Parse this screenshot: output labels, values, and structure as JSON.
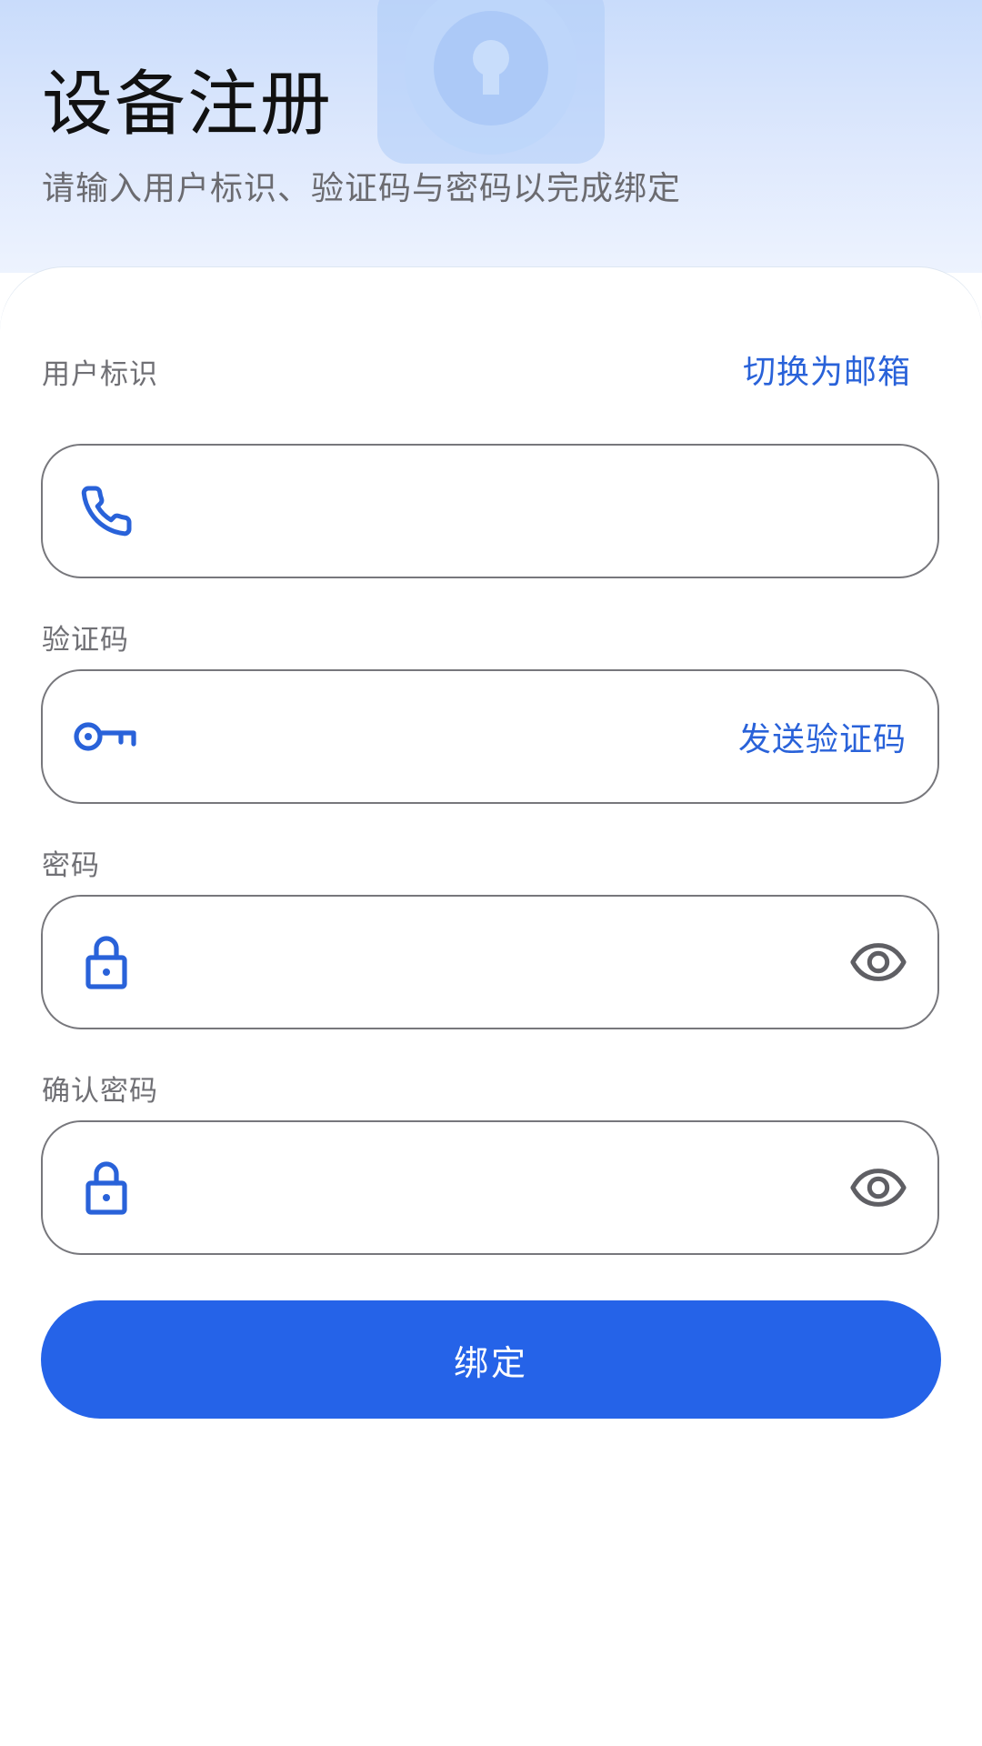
{
  "header": {
    "title": "设备注册",
    "subtitle": "请输入用户标识、验证码与密码以完成绑定"
  },
  "form": {
    "user_id": {
      "label": "用户标识",
      "switch_link": "切换为邮箱",
      "value": "",
      "icon": "phone-icon"
    },
    "verify_code": {
      "label": "验证码",
      "send_link": "发送验证码",
      "value": "",
      "icon": "key-icon"
    },
    "password": {
      "label": "密码",
      "value": "",
      "icon": "lock-icon",
      "toggle_icon": "eye-icon"
    },
    "confirm_password": {
      "label": "确认密码",
      "value": "",
      "icon": "lock-icon",
      "toggle_icon": "eye-icon"
    },
    "submit_label": "绑定"
  },
  "colors": {
    "accent": "#2563e8",
    "link": "#2962d9",
    "border": "#77777c",
    "label": "#707075"
  }
}
